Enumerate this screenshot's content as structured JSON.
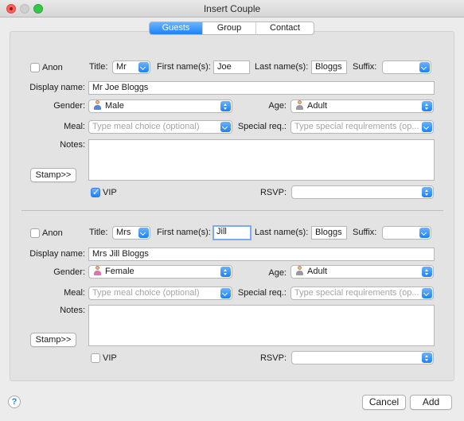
{
  "window": {
    "title": "Insert Couple"
  },
  "tabs": [
    "Guests",
    "Group",
    "Contact"
  ],
  "guest1": {
    "anon_label": "Anon",
    "title_label": "Title:",
    "title_value": "Mr",
    "first_label": "First name(s):",
    "first_value": "Joe",
    "last_label": "Last name(s):",
    "last_value": "Bloggs",
    "suffix_label": "Suffix:",
    "display_label": "Display name:",
    "display_value": "Mr Joe Bloggs",
    "gender_label": "Gender:",
    "gender_value": "Male",
    "age_label": "Age:",
    "age_value": "Adult",
    "meal_label": "Meal:",
    "meal_placeholder": "Type meal choice (optional)",
    "special_label": "Special req.:",
    "special_placeholder": "Type special requirements (op...",
    "notes_label": "Notes:",
    "stamp_label": "Stamp>>",
    "vip_label": "VIP",
    "vip_checked": true,
    "rsvp_label": "RSVP:"
  },
  "guest2": {
    "anon_label": "Anon",
    "title_label": "Title:",
    "title_value": "Mrs",
    "first_label": "First name(s):",
    "first_value": "Jill",
    "last_label": "Last name(s):",
    "last_value": "Bloggs",
    "suffix_label": "Suffix:",
    "display_label": "Display name:",
    "display_value": "Mrs Jill Bloggs",
    "gender_label": "Gender:",
    "gender_value": "Female",
    "age_label": "Age:",
    "age_value": "Adult",
    "meal_label": "Meal:",
    "meal_placeholder": "Type meal choice (optional)",
    "special_label": "Special req.:",
    "special_placeholder": "Type special requirements (op...",
    "notes_label": "Notes:",
    "stamp_label": "Stamp>>",
    "vip_label": "VIP",
    "vip_checked": false,
    "rsvp_label": "RSVP:"
  },
  "footer": {
    "help_label": "?",
    "cancel_label": "Cancel",
    "add_label": "Add"
  },
  "colors": {
    "accent": "#1a82fb",
    "close": "#fc605c",
    "zoom": "#34c84a"
  }
}
